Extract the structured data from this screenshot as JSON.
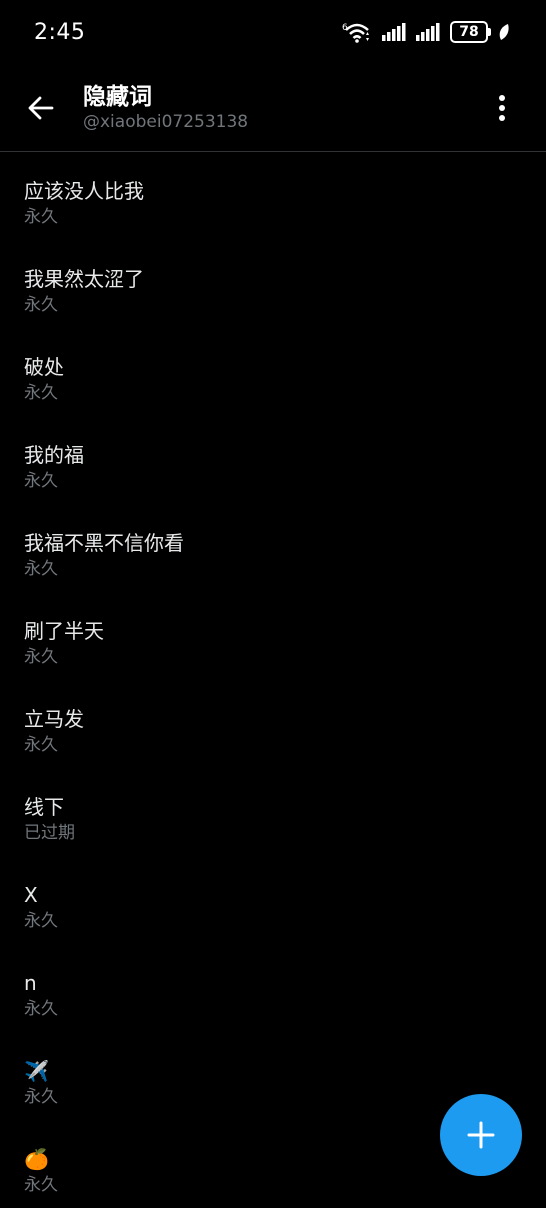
{
  "status_bar": {
    "time": "2:45",
    "battery": "78",
    "wifi_badge": "6"
  },
  "header": {
    "title": "隐藏词",
    "subtitle": "@xiaobei07253138",
    "back_icon": "arrow-left-icon",
    "more_icon": "more-vertical-icon"
  },
  "muted_words": [
    {
      "word": "应该没人比我",
      "duration": "永久"
    },
    {
      "word": "我果然太涩了",
      "duration": "永久"
    },
    {
      "word": "破处",
      "duration": "永久"
    },
    {
      "word": "我的福",
      "duration": "永久"
    },
    {
      "word": "我福不黑不信你看",
      "duration": "永久"
    },
    {
      "word": "刷了半天",
      "duration": "永久"
    },
    {
      "word": "立马发",
      "duration": "永久"
    },
    {
      "word": "线下",
      "duration": "已过期"
    },
    {
      "word": "X",
      "duration": "永久"
    },
    {
      "word": "n",
      "duration": "永久"
    },
    {
      "word": "✈️",
      "duration": "永久"
    },
    {
      "word": "🍊",
      "duration": "永久"
    }
  ],
  "fab": {
    "icon": "plus-icon"
  },
  "colors": {
    "accent": "#1d9bf0",
    "background": "#000000",
    "secondary_text": "#71767b"
  }
}
